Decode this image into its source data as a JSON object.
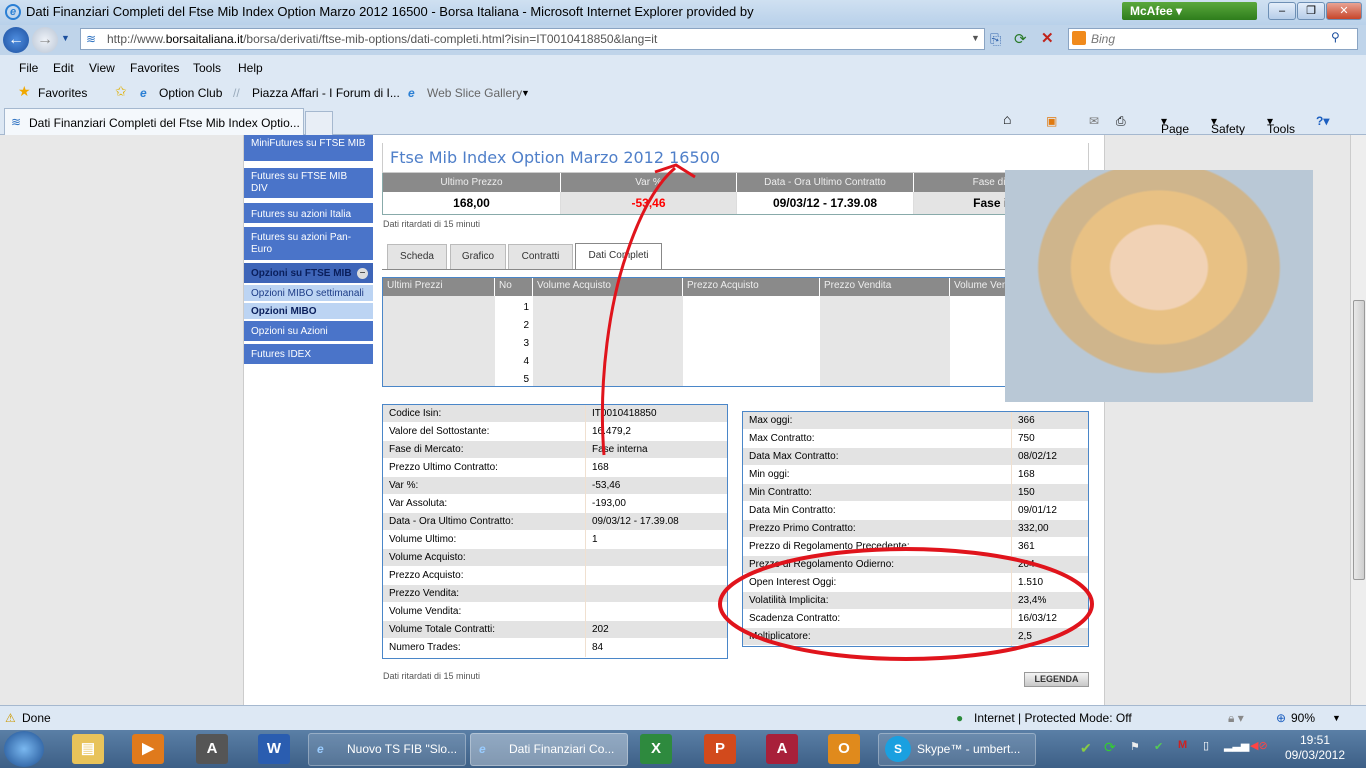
{
  "window": {
    "title": "Dati Finanziari Completi del Ftse Mib Index Option Marzo 2012 16500 - Borsa Italiana - Microsoft Internet Explorer provided by",
    "addon": "McAfee"
  },
  "address": {
    "prefix": "http://www.",
    "domain": "borsaitaliana.it",
    "path": "/borsa/derivati/ftse-mib-options/dati-completi.html?isin=IT0010418850&lang=it",
    "search_placeholder": "Bing"
  },
  "menu": [
    "File",
    "Edit",
    "View",
    "Favorites",
    "Tools",
    "Help"
  ],
  "favorites": {
    "label": "Favorites",
    "items": [
      "Option Club",
      "Piazza Affari - I Forum di I...",
      "Web Slice Gallery"
    ]
  },
  "tab": {
    "title": "Dati Finanziari Completi del Ftse Mib Index Optio..."
  },
  "command_bar": {
    "page": "Page",
    "safety": "Safety",
    "tools": "Tools"
  },
  "sidebar": [
    {
      "label": "MiniFutures su FTSE MIB",
      "type": "item"
    },
    {
      "label": "Futures su FTSE MIB DIV",
      "type": "item"
    },
    {
      "label": "Futures su azioni Italia",
      "type": "item"
    },
    {
      "label": "Futures su azioni Pan-Euro",
      "type": "item"
    },
    {
      "label": "Opzioni su FTSE MIB",
      "type": "header"
    },
    {
      "label": "Opzioni MIBO settimanali",
      "type": "sub"
    },
    {
      "label": "Opzioni MIBO",
      "type": "sub-active"
    },
    {
      "label": "Opzioni su Azioni",
      "type": "item"
    },
    {
      "label": "Futures IDEX",
      "type": "item"
    }
  ],
  "page_title": "Ftse Mib Index Option Marzo 2012 16500",
  "summary": {
    "headers": [
      "Ultimo Prezzo",
      "Var %",
      "Data - Ora Ultimo Contratto",
      "Fase di Mercato"
    ],
    "values": [
      "168,00",
      "-53,46",
      "09/03/12 - 17.39.08",
      "Fase interna"
    ],
    "negative_color": "#ff0000"
  },
  "delay_note": "Dati ritardati di 15 minuti",
  "tabs": [
    "Scheda",
    "Grafico",
    "Contratti",
    "Dati Completi"
  ],
  "active_tab": "Dati Completi",
  "book": {
    "headers": [
      "Ultimi Prezzi",
      "No",
      "Volume Acquisto",
      "Prezzo Acquisto",
      "Prezzo Vendita",
      "Volume Vendita"
    ],
    "rows": [
      "1",
      "2",
      "3",
      "4",
      "5"
    ]
  },
  "left_details": [
    [
      "Codice Isin:",
      "IT0010418850"
    ],
    [
      "Valore del Sottostante:",
      "16.479,2"
    ],
    [
      "Fase di Mercato:",
      "Fase interna"
    ],
    [
      "Prezzo Ultimo Contratto:",
      "168"
    ],
    [
      "Var %:",
      "-53,46"
    ],
    [
      "Var Assoluta:",
      "-193,00"
    ],
    [
      "Data - Ora Ultimo Contratto:",
      "09/03/12 - 17.39.08"
    ],
    [
      "Volume Ultimo:",
      "1"
    ],
    [
      "Volume Acquisto:",
      ""
    ],
    [
      "Prezzo Acquisto:",
      ""
    ],
    [
      "Prezzo Vendita:",
      ""
    ],
    [
      "Volume Vendita:",
      ""
    ],
    [
      "Volume Totale Contratti:",
      "202"
    ],
    [
      "Numero Trades:",
      "84"
    ]
  ],
  "right_details": [
    [
      "Max oggi:",
      "366"
    ],
    [
      "Max Contratto:",
      "750"
    ],
    [
      "Data Max Contratto:",
      "08/02/12"
    ],
    [
      "Min oggi:",
      "168"
    ],
    [
      "Min Contratto:",
      "150"
    ],
    [
      "Data Min Contratto:",
      "09/01/12"
    ],
    [
      "Prezzo Primo Contratto:",
      "332,00"
    ],
    [
      "Prezzo di Regolamento Precedente:",
      "361"
    ],
    [
      "Prezzo di Regolamento Odierno:",
      "204"
    ],
    [
      "Open Interest Oggi:",
      "1.510"
    ],
    [
      "Volatilità Implicita:",
      "23,4%"
    ],
    [
      "Scadenza Contratto:",
      "16/03/12"
    ],
    [
      "Moltiplicatore:",
      "2,5"
    ]
  ],
  "legenda": "LEGENDA",
  "annotation_color": "#e0141c",
  "status": {
    "text": "Done",
    "zone": "Internet | Protected Mode: Off",
    "zoom": "90%"
  },
  "taskbar": {
    "buttons": [
      "Nuovo TS FIB \"Slo...",
      "Dati Finanziari Co...",
      "Skype™ - umbert..."
    ],
    "time": "19:51",
    "date": "09/03/2012"
  }
}
